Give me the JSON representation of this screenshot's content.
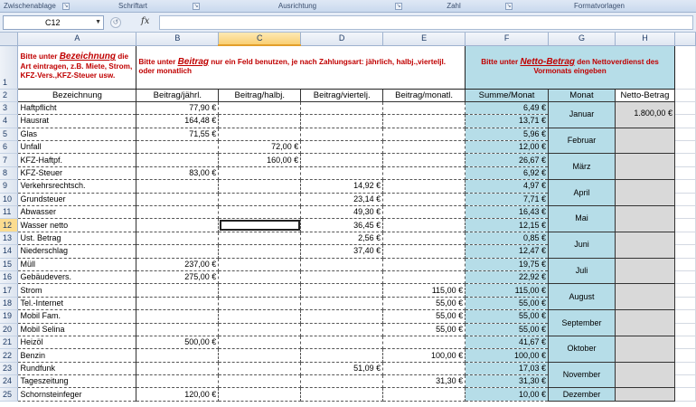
{
  "ribbon": {
    "groups": [
      "Zwischenablage",
      "Schriftart",
      "Ausrichtung",
      "Zahl",
      "Formatvorlagen"
    ]
  },
  "formula_bar": {
    "name_box": "C12",
    "fx_label": "fx",
    "cancel_glyph": "↺",
    "value": ""
  },
  "columns": [
    "A",
    "B",
    "C",
    "D",
    "E",
    "F",
    "G",
    "H"
  ],
  "selected_column": "C",
  "selected_row": "12",
  "instructions": {
    "a_pre": "Bitte unter ",
    "a_key": "Bezeichnung",
    "a_post": " die Art eintragen, z.B. Miete, Strom, KFZ-Vers.,KFZ-Steuer usw.",
    "b_pre": "Bitte unter ",
    "b_key": "Beitrag",
    "b_post": " nur ein Feld benutzen, je nach Zahlungsart: jährlich, halbj.,vierteljl. oder monatlich",
    "f_pre": "Bitte unter ",
    "f_key": "Netto-Betrag",
    "f_post": " den Nettoverdienst des Vormonats eingeben"
  },
  "headers": {
    "bezeichnung": "Bezeichnung",
    "jaehrl": "Beitrag/jährl.",
    "halbj": "Beitrag/halbj.",
    "viertelj": "Beitrag/viertelj.",
    "monatl": "Beitrag/monatl.",
    "summe": "Summe/Monat",
    "monat": "Monat",
    "netto": "Netto-Betrag"
  },
  "rows": [
    {
      "num": "3",
      "name": "Haftpflicht",
      "b": "77,90 €",
      "c": "",
      "d": "",
      "e": "",
      "f": "6,49 €"
    },
    {
      "num": "4",
      "name": "Hausrat",
      "b": "164,48 €",
      "c": "",
      "d": "",
      "e": "",
      "f": "13,71 €"
    },
    {
      "num": "5",
      "name": "Glas",
      "b": "71,55 €",
      "c": "",
      "d": "",
      "e": "",
      "f": "5,96 €"
    },
    {
      "num": "6",
      "name": "Unfall",
      "b": "",
      "c": "72,00 €",
      "d": "",
      "e": "",
      "f": "12,00 €"
    },
    {
      "num": "7",
      "name": "KFZ-Haftpf.",
      "b": "",
      "c": "160,00 €",
      "d": "",
      "e": "",
      "f": "26,67 €"
    },
    {
      "num": "8",
      "name": "KFZ-Steuer",
      "b": "83,00 €",
      "c": "",
      "d": "",
      "e": "",
      "f": "6,92 €"
    },
    {
      "num": "9",
      "name": "Verkehrsrechtsch.",
      "b": "",
      "c": "",
      "d": "14,92 €",
      "e": "",
      "f": "4,97 €"
    },
    {
      "num": "10",
      "name": "Grundsteuer",
      "b": "",
      "c": "",
      "d": "23,14 €",
      "e": "",
      "f": "7,71 €"
    },
    {
      "num": "11",
      "name": "Abwasser",
      "b": "",
      "c": "",
      "d": "49,30 €",
      "e": "",
      "f": "16,43 €"
    },
    {
      "num": "12",
      "name": "Wasser netto",
      "b": "",
      "c": "",
      "d": "36,45 €",
      "e": "",
      "f": "12,15 €"
    },
    {
      "num": "13",
      "name": "Ust. Betrag",
      "b": "",
      "c": "",
      "d": "2,56 €",
      "e": "",
      "f": "0,85 €"
    },
    {
      "num": "14",
      "name": "Niederschlag",
      "b": "",
      "c": "",
      "d": "37,40 €",
      "e": "",
      "f": "12,47 €"
    },
    {
      "num": "15",
      "name": "Müll",
      "b": "237,00 €",
      "c": "",
      "d": "",
      "e": "",
      "f": "19,75 €"
    },
    {
      "num": "16",
      "name": "Gebäudevers.",
      "b": "275,00 €",
      "c": "",
      "d": "",
      "e": "",
      "f": "22,92 €"
    },
    {
      "num": "17",
      "name": "Strom",
      "b": "",
      "c": "",
      "d": "",
      "e": "115,00 €",
      "f": "115,00 €"
    },
    {
      "num": "18",
      "name": "Tel.-Internet",
      "b": "",
      "c": "",
      "d": "",
      "e": "55,00 €",
      "f": "55,00 €"
    },
    {
      "num": "19",
      "name": "Mobil Fam.",
      "b": "",
      "c": "",
      "d": "",
      "e": "55,00 €",
      "f": "55,00 €"
    },
    {
      "num": "20",
      "name": "Mobil Selina",
      "b": "",
      "c": "",
      "d": "",
      "e": "55,00 €",
      "f": "55,00 €"
    },
    {
      "num": "21",
      "name": "Heizöl",
      "b": "500,00 €",
      "c": "",
      "d": "",
      "e": "",
      "f": "41,67 €"
    },
    {
      "num": "22",
      "name": "Benzin",
      "b": "",
      "c": "",
      "d": "",
      "e": "100,00 €",
      "f": "100,00 €"
    },
    {
      "num": "23",
      "name": "Rundfunk",
      "b": "",
      "c": "",
      "d": "51,09 €",
      "e": "",
      "f": "17,03 €"
    },
    {
      "num": "24",
      "name": "Tageszeitung",
      "b": "",
      "c": "",
      "d": "",
      "e": "31,30 €",
      "f": "31,30 €"
    },
    {
      "num": "25",
      "name": "Schornsteinfeger",
      "b": "120,00 €",
      "c": "",
      "d": "",
      "e": "",
      "f": "10,00 €"
    }
  ],
  "months": [
    {
      "name": "Januar",
      "netto": "1.800,00 €"
    },
    {
      "name": "Februar",
      "netto": ""
    },
    {
      "name": "März",
      "netto": ""
    },
    {
      "name": "April",
      "netto": ""
    },
    {
      "name": "Mai",
      "netto": ""
    },
    {
      "name": "Juni",
      "netto": ""
    },
    {
      "name": "Juli",
      "netto": ""
    },
    {
      "name": "August",
      "netto": ""
    },
    {
      "name": "September",
      "netto": ""
    },
    {
      "name": "Oktober",
      "netto": ""
    },
    {
      "name": "November",
      "netto": ""
    },
    {
      "name": "Dezember",
      "netto": ""
    }
  ],
  "colors": {
    "accent_blue": "#b6dde8",
    "instruction_red": "#c00000",
    "net_gray": "#d9d9d9"
  }
}
